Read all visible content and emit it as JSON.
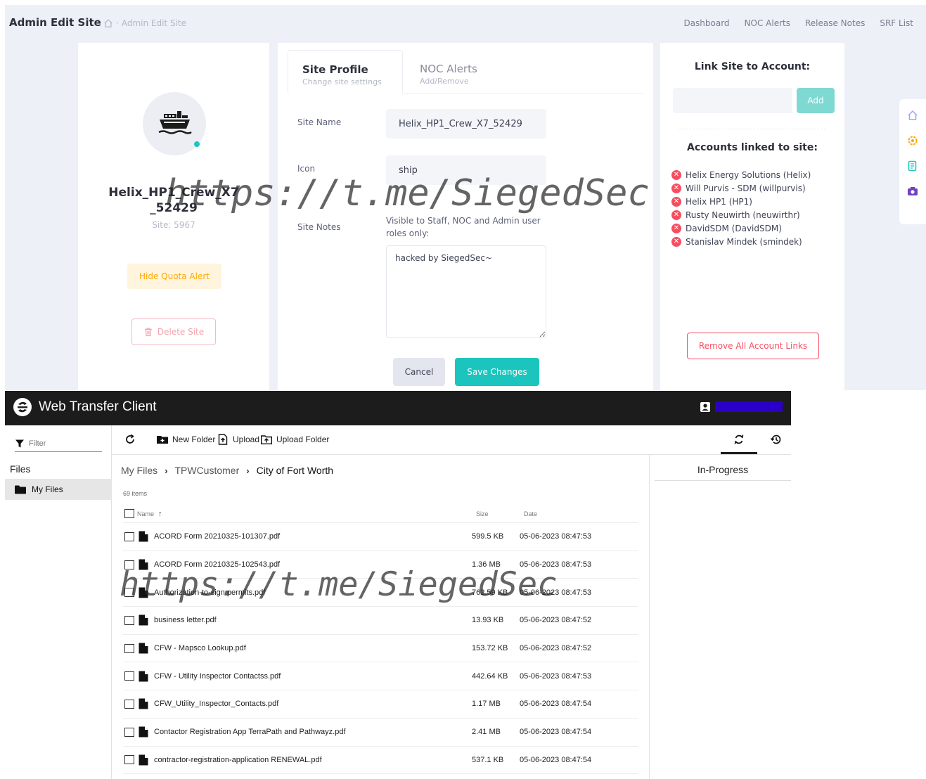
{
  "admin": {
    "title": "Admin Edit Site",
    "breadcrumb": "Admin Edit Site",
    "nav": [
      "Dashboard",
      "NOC Alerts",
      "Release Notes",
      "SRF List"
    ],
    "site": {
      "name": "Helix_HP1_Crew_X7_52429",
      "id_label": "Site: 5967",
      "hide_quota_label": "Hide Quota Alert",
      "delete_label": "Delete Site",
      "status_color": "#1bc5bd"
    },
    "tabs": [
      {
        "title": "Site Profile",
        "subtitle": "Change site settings"
      },
      {
        "title": "NOC Alerts",
        "subtitle": "Add/Remove"
      }
    ],
    "form": {
      "site_name_label": "Site Name",
      "site_name_value": "Helix_HP1_Crew_X7_52429",
      "icon_label": "Icon",
      "icon_value": "ship",
      "notes_label": "Site Notes",
      "notes_hint": "Visible to Staff, NOC and Admin user roles only:",
      "notes_value": "hacked by SiegedSec~",
      "cancel_label": "Cancel",
      "save_label": "Save Changes"
    },
    "link": {
      "title": "Link Site to Account:",
      "add_label": "Add",
      "linked_title": "Accounts linked to site:",
      "accounts": [
        "Helix Energy Solutions (Helix)",
        "Will Purvis - SDM (willpurvis)",
        "Helix HP1 (HP1)",
        "Rusty Neuwirth (neuwirthr)",
        "DavidSDM (DavidSDM)",
        "Stanislav Mindek (smindek)"
      ],
      "remove_all_label": "Remove All Account Links"
    },
    "tool_icons": [
      "home-icon",
      "gear-icon",
      "notes-icon",
      "camera-icon"
    ]
  },
  "wtc": {
    "title": "Web Transfer Client",
    "filter_placeholder": "Filter",
    "files_heading": "Files",
    "my_files_label": "My Files",
    "toolbar": {
      "new_folder": "New Folder",
      "upload": "Upload",
      "upload_folder": "Upload Folder"
    },
    "breadcrumb": [
      "My Files",
      "TPWCustomer",
      "City of Fort Worth"
    ],
    "item_count": "69 items",
    "columns": {
      "name": "Name",
      "size": "Size",
      "date": "Date"
    },
    "files": [
      {
        "name": "ACORD Form 20210325-101307.pdf",
        "size": "599.5 KB",
        "date": "05-06-2023 08:47:53"
      },
      {
        "name": "ACORD Form 20210325-102543.pdf",
        "size": "1.36 MB",
        "date": "05-06-2023 08:47:53"
      },
      {
        "name": "Authorization-to-sign permits.pdf",
        "size": "762.59 KB",
        "date": "05-06-2023 08:47:53"
      },
      {
        "name": "business letter.pdf",
        "size": "13.93 KB",
        "date": "05-06-2023 08:47:52"
      },
      {
        "name": "CFW - Mapsco Lookup.pdf",
        "size": "153.72 KB",
        "date": "05-06-2023 08:47:52"
      },
      {
        "name": "CFW - Utility Inspector Contactss.pdf",
        "size": "442.64 KB",
        "date": "05-06-2023 08:47:53"
      },
      {
        "name": "CFW_Utility_Inspector_Contacts.pdf",
        "size": "1.17 MB",
        "date": "05-06-2023 08:47:54"
      },
      {
        "name": "Contactor Registration App TerraPath and Pathwayz.pdf",
        "size": "2.41 MB",
        "date": "05-06-2023 08:47:54"
      },
      {
        "name": "contractor-registration-application RENEWAL.pdf",
        "size": "537.1 KB",
        "date": "05-06-2023 08:47:54"
      }
    ],
    "in_progress_label": "In-Progress"
  },
  "watermark": "https://t.me/SiegedSec",
  "colors": {
    "accent": "#1bc5bd",
    "danger": "#f64e60",
    "warning": "#ffa800",
    "header": "#1c1c1c"
  }
}
